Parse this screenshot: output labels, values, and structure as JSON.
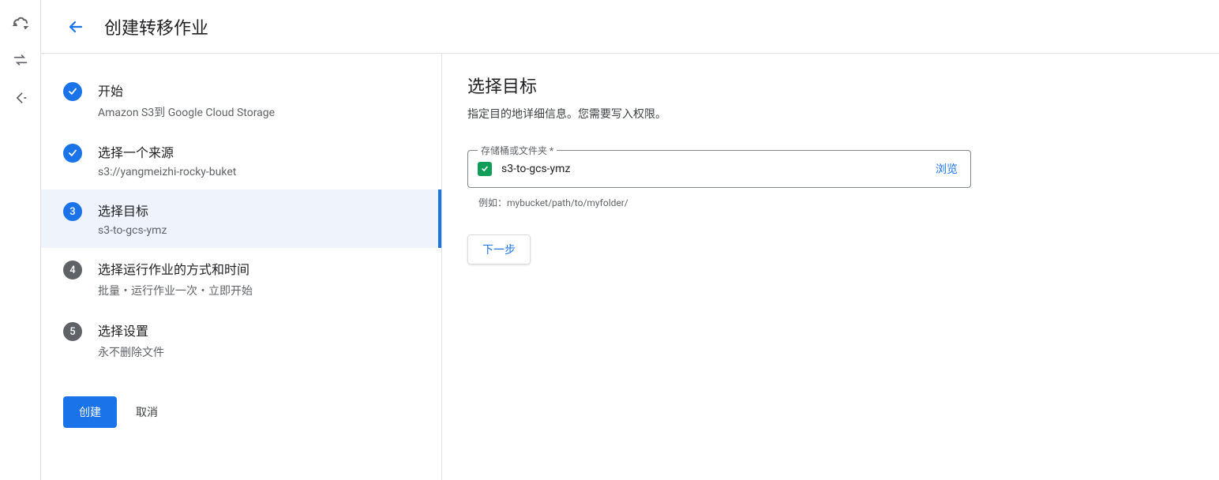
{
  "header": {
    "page_title": "创建转移作业"
  },
  "steps": [
    {
      "title": "开始",
      "sub": "Amazon S3到 Google Cloud Storage",
      "status": "done"
    },
    {
      "title": "选择一个来源",
      "sub": "s3://yangmeizhi-rocky-buket",
      "status": "done"
    },
    {
      "title": "选择目标",
      "sub": "s3-to-gcs-ymz",
      "status": "active",
      "num": "3"
    },
    {
      "title": "选择运行作业的方式和时间",
      "sub": "批量・运行作业一次・立即开始",
      "status": "pending",
      "num": "4"
    },
    {
      "title": "选择设置",
      "sub": "永不删除文件",
      "status": "pending",
      "num": "5"
    }
  ],
  "actions": {
    "create_label": "创建",
    "cancel_label": "取消"
  },
  "detail": {
    "title": "选择目标",
    "description": "指定目的地详细信息。您需要写入权限。",
    "field_label": "存储桶或文件夹 *",
    "field_value": "s3-to-gcs-ymz",
    "browse_label": "浏览",
    "hint": "例如：mybucket/path/to/myfolder/",
    "next_label": "下一步"
  }
}
